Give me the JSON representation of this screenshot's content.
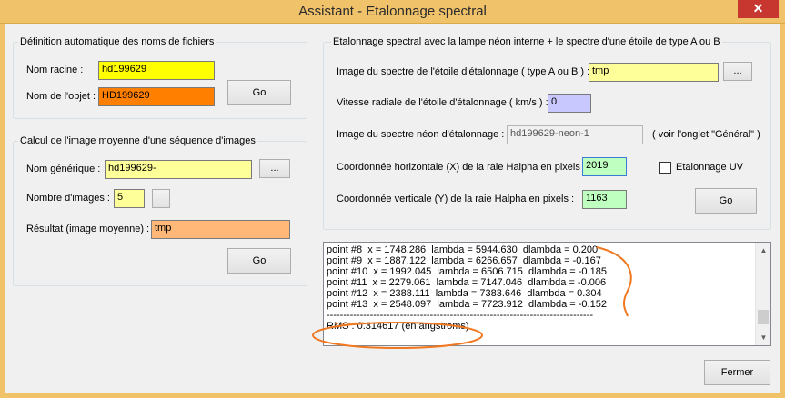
{
  "window": {
    "title": "Assistant - Etalonnage spectral",
    "close_glyph": "✕"
  },
  "group_names": {
    "title": "Définition automatique des noms de fichiers",
    "racine_label": "Nom racine :",
    "racine_value": "hd199629",
    "objet_label": "Nom de l'objet :",
    "objet_value": "HD199629",
    "go_label": "Go"
  },
  "group_mean": {
    "title": "Calcul de l'image moyenne d'une séquence d'images",
    "generic_label": "Nom générique :",
    "generic_value": "hd199629-",
    "browse_label": "...",
    "count_label": "Nombre d'images :",
    "count_value": "5",
    "result_label": "Résultat (image moyenne) :",
    "result_value": "tmp",
    "go_label": "Go"
  },
  "group_calib": {
    "title": "Etalonnage spectral avec la lampe néon interne + le spectre d'une étoile de type A ou B",
    "star_label": "Image du spectre de l'étoile d'étalonnage ( type A ou B ) :",
    "star_value": "tmp",
    "browse_label": "...",
    "vel_label": "Vitesse radiale de l'étoile d'étalonnage ( km/s ) :",
    "vel_value": "0",
    "neon_label": "Image du spectre néon d'étalonnage :",
    "neon_value": "hd199629-neon-1",
    "neon_note": "( voir l'onglet \"Général\" )",
    "x_label": "Coordonnée horizontale (X) de la raie Halpha en pixels :",
    "x_value": "2019",
    "uv_label": "Etalonnage UV",
    "y_label": "Coordonnée verticale (Y) de la raie Halpha en pixels :",
    "y_value": "1163",
    "go_label": "Go"
  },
  "log": {
    "lines": [
      "point #8  x = 1748.286  lambda = 5944.630  dlambda = 0.200",
      "point #9  x = 1887.122  lambda = 6266.657  dlambda = -0.167",
      "point #10  x = 1992.045  lambda = 6506.715  dlambda = -0.185",
      "point #11  x = 2279.061  lambda = 7147.046  dlambda = -0.006",
      "point #12  x = 2388.111  lambda = 7383.646  dlambda = 0.304",
      "point #13  x = 2548.097  lambda = 7723.912  dlambda = -0.152",
      "--------------------------------------------------------------------------------",
      "RMS : 0.314617 (en angstroms)"
    ]
  },
  "footer": {
    "close_label": "Fermer"
  },
  "colors": {
    "yellow": "#ffff00",
    "orange": "#ff7f00",
    "light_yellow": "#ffff99",
    "light_orange": "#ffb878",
    "lavender": "#c8c8ff",
    "light_green": "#bfffbf",
    "annotation": "#f07820"
  }
}
